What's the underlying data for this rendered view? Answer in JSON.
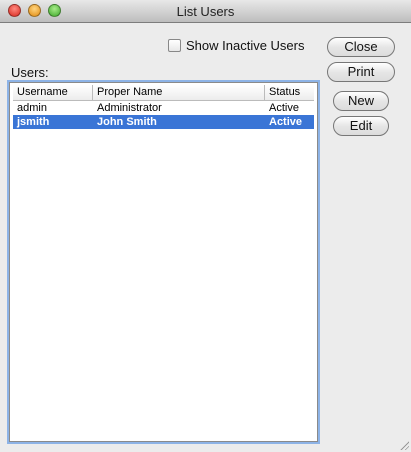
{
  "window": {
    "title": "List Users"
  },
  "options": {
    "show_inactive_label": "Show Inactive Users",
    "show_inactive_checked": false
  },
  "buttons": {
    "close": "Close",
    "print": "Print",
    "new": "New",
    "edit": "Edit"
  },
  "users_label": "Users:",
  "table": {
    "columns": [
      "Username",
      "Proper Name",
      "Status"
    ],
    "rows": [
      {
        "username": "admin",
        "proper_name": "Administrator",
        "status": "Active",
        "selected": false
      },
      {
        "username": "jsmith",
        "proper_name": "John Smith",
        "status": "Active",
        "selected": true
      }
    ]
  },
  "colors": {
    "selection": "#3a75d6",
    "focus_ring": "#8db3e6"
  }
}
